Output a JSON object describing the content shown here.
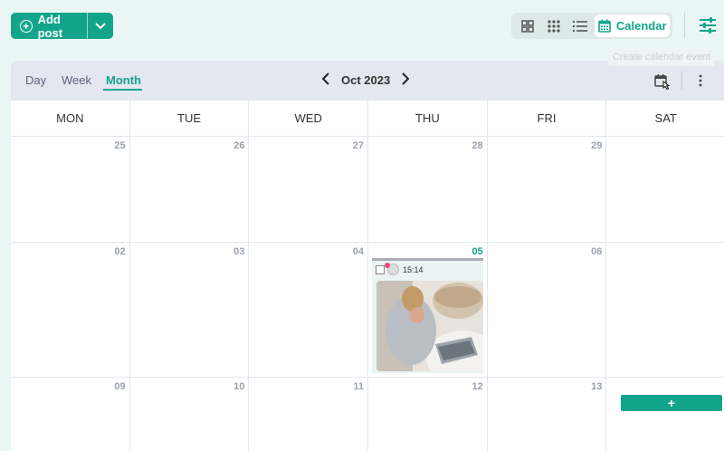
{
  "toolbar": {
    "add_post_label": "Add post",
    "calendar_label": "Calendar",
    "tooltip": "Create calendar event"
  },
  "calendar": {
    "tabs": [
      "Day",
      "Week",
      "Month"
    ],
    "active_tab": "Month",
    "period_label": "Oct 2023",
    "weekdays": [
      "MON",
      "TUE",
      "WED",
      "THU",
      "FRI",
      "SAT"
    ],
    "weeks": [
      [
        "25",
        "26",
        "27",
        "28",
        "29",
        ""
      ],
      [
        "02",
        "03",
        "04",
        "05",
        "06",
        ""
      ],
      [
        "09",
        "10",
        "11",
        "12",
        "13",
        ""
      ]
    ],
    "today": "05",
    "post": {
      "time": "15:14"
    },
    "add_button": "+"
  },
  "colors": {
    "accent": "#13a58c",
    "header_bg": "#e4e6f0",
    "page_bg": "#eaf6f4"
  }
}
